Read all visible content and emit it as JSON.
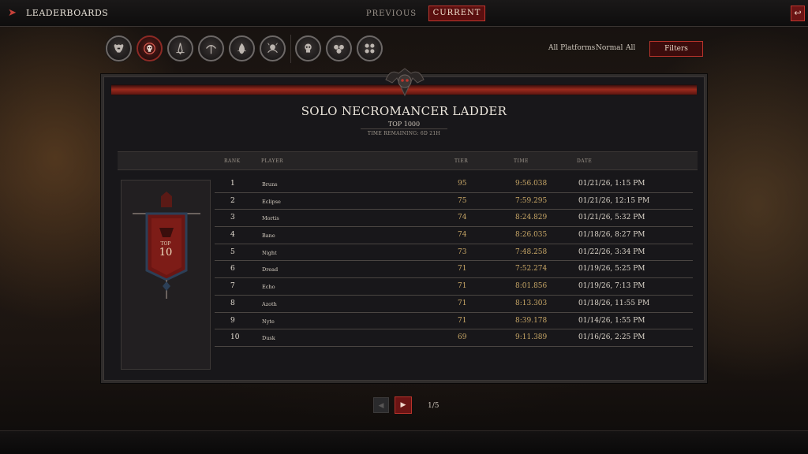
{
  "header": {
    "back_icon": "arrow-right-icon",
    "title": "LEADERBOARDS",
    "tabs": [
      {
        "label": "PREVIOUS",
        "active": false
      },
      {
        "label": "CURRENT",
        "active": true
      }
    ],
    "close_icon": "return-arrow-icon"
  },
  "class_icons": [
    {
      "name": "barbarian",
      "icon": "horned-helm-icon",
      "active": false
    },
    {
      "name": "necromancer",
      "icon": "skull-ring-icon",
      "active": true
    },
    {
      "name": "rogue",
      "icon": "dagger-icon",
      "active": false
    },
    {
      "name": "druid",
      "icon": "bow-icon",
      "active": false
    },
    {
      "name": "sorcerer",
      "icon": "flame-icon",
      "active": false
    },
    {
      "name": "spiritborn",
      "icon": "spirit-icon",
      "active": false
    },
    {
      "name": "party-2",
      "icon": "two-skulls-icon",
      "active": false
    },
    {
      "name": "party-3",
      "icon": "three-skulls-icon",
      "active": false
    },
    {
      "name": "party-4",
      "icon": "four-skulls-icon",
      "active": false
    }
  ],
  "filters": {
    "platform": "All Platforms",
    "mode": "Normal",
    "scope": "All",
    "button_label": "Filters"
  },
  "ladder": {
    "title": "SOLO NECROMANCER LADDER",
    "subtitle": "TOP 1000",
    "time_remaining": "TIME REMAINING: 6D 21H"
  },
  "table": {
    "columns": [
      "RANK",
      "PLAYER",
      "TIER",
      "TIME",
      "DATE"
    ],
    "rows": [
      {
        "rank": "1",
        "player": "Bruns",
        "tier": "95",
        "time": "9:56.038",
        "date": "01/21/26, 1:15 PM"
      },
      {
        "rank": "2",
        "player": "Eclipse",
        "tier": "75",
        "time": "7:59.295",
        "date": "01/21/26, 12:15 PM"
      },
      {
        "rank": "3",
        "player": "Mortis",
        "tier": "74",
        "time": "8:24.829",
        "date": "01/21/26, 5:32 PM"
      },
      {
        "rank": "4",
        "player": "Bane",
        "tier": "74",
        "time": "8:26.035",
        "date": "01/18/26, 8:27 PM"
      },
      {
        "rank": "5",
        "player": "Night",
        "tier": "73",
        "time": "7:48.258",
        "date": "01/22/26, 3:34 PM"
      },
      {
        "rank": "6",
        "player": "Dread",
        "tier": "71",
        "time": "7:52.274",
        "date": "01/19/26, 5:25 PM"
      },
      {
        "rank": "7",
        "player": "Echo",
        "tier": "71",
        "time": "8:01.856",
        "date": "01/19/26, 7:13 PM"
      },
      {
        "rank": "8",
        "player": "Azoth",
        "tier": "71",
        "time": "8:13.303",
        "date": "01/18/26, 11:55 PM"
      },
      {
        "rank": "9",
        "player": "Nyte",
        "tier": "71",
        "time": "8:39.178",
        "date": "01/14/26, 1:55 PM"
      },
      {
        "rank": "10",
        "player": "Dusk",
        "tier": "69",
        "time": "9:11.389",
        "date": "01/16/26, 2:25 PM"
      }
    ]
  },
  "banner": {
    "label": "TOP",
    "value": "10",
    "icon": "banner-icon"
  },
  "pagination": {
    "prev_icon": "chevron-left-icon",
    "next_icon": "chevron-right-icon",
    "indicator": "1/5"
  },
  "colors": {
    "accent_red": "#b8332b",
    "gold": "#c9a867"
  }
}
